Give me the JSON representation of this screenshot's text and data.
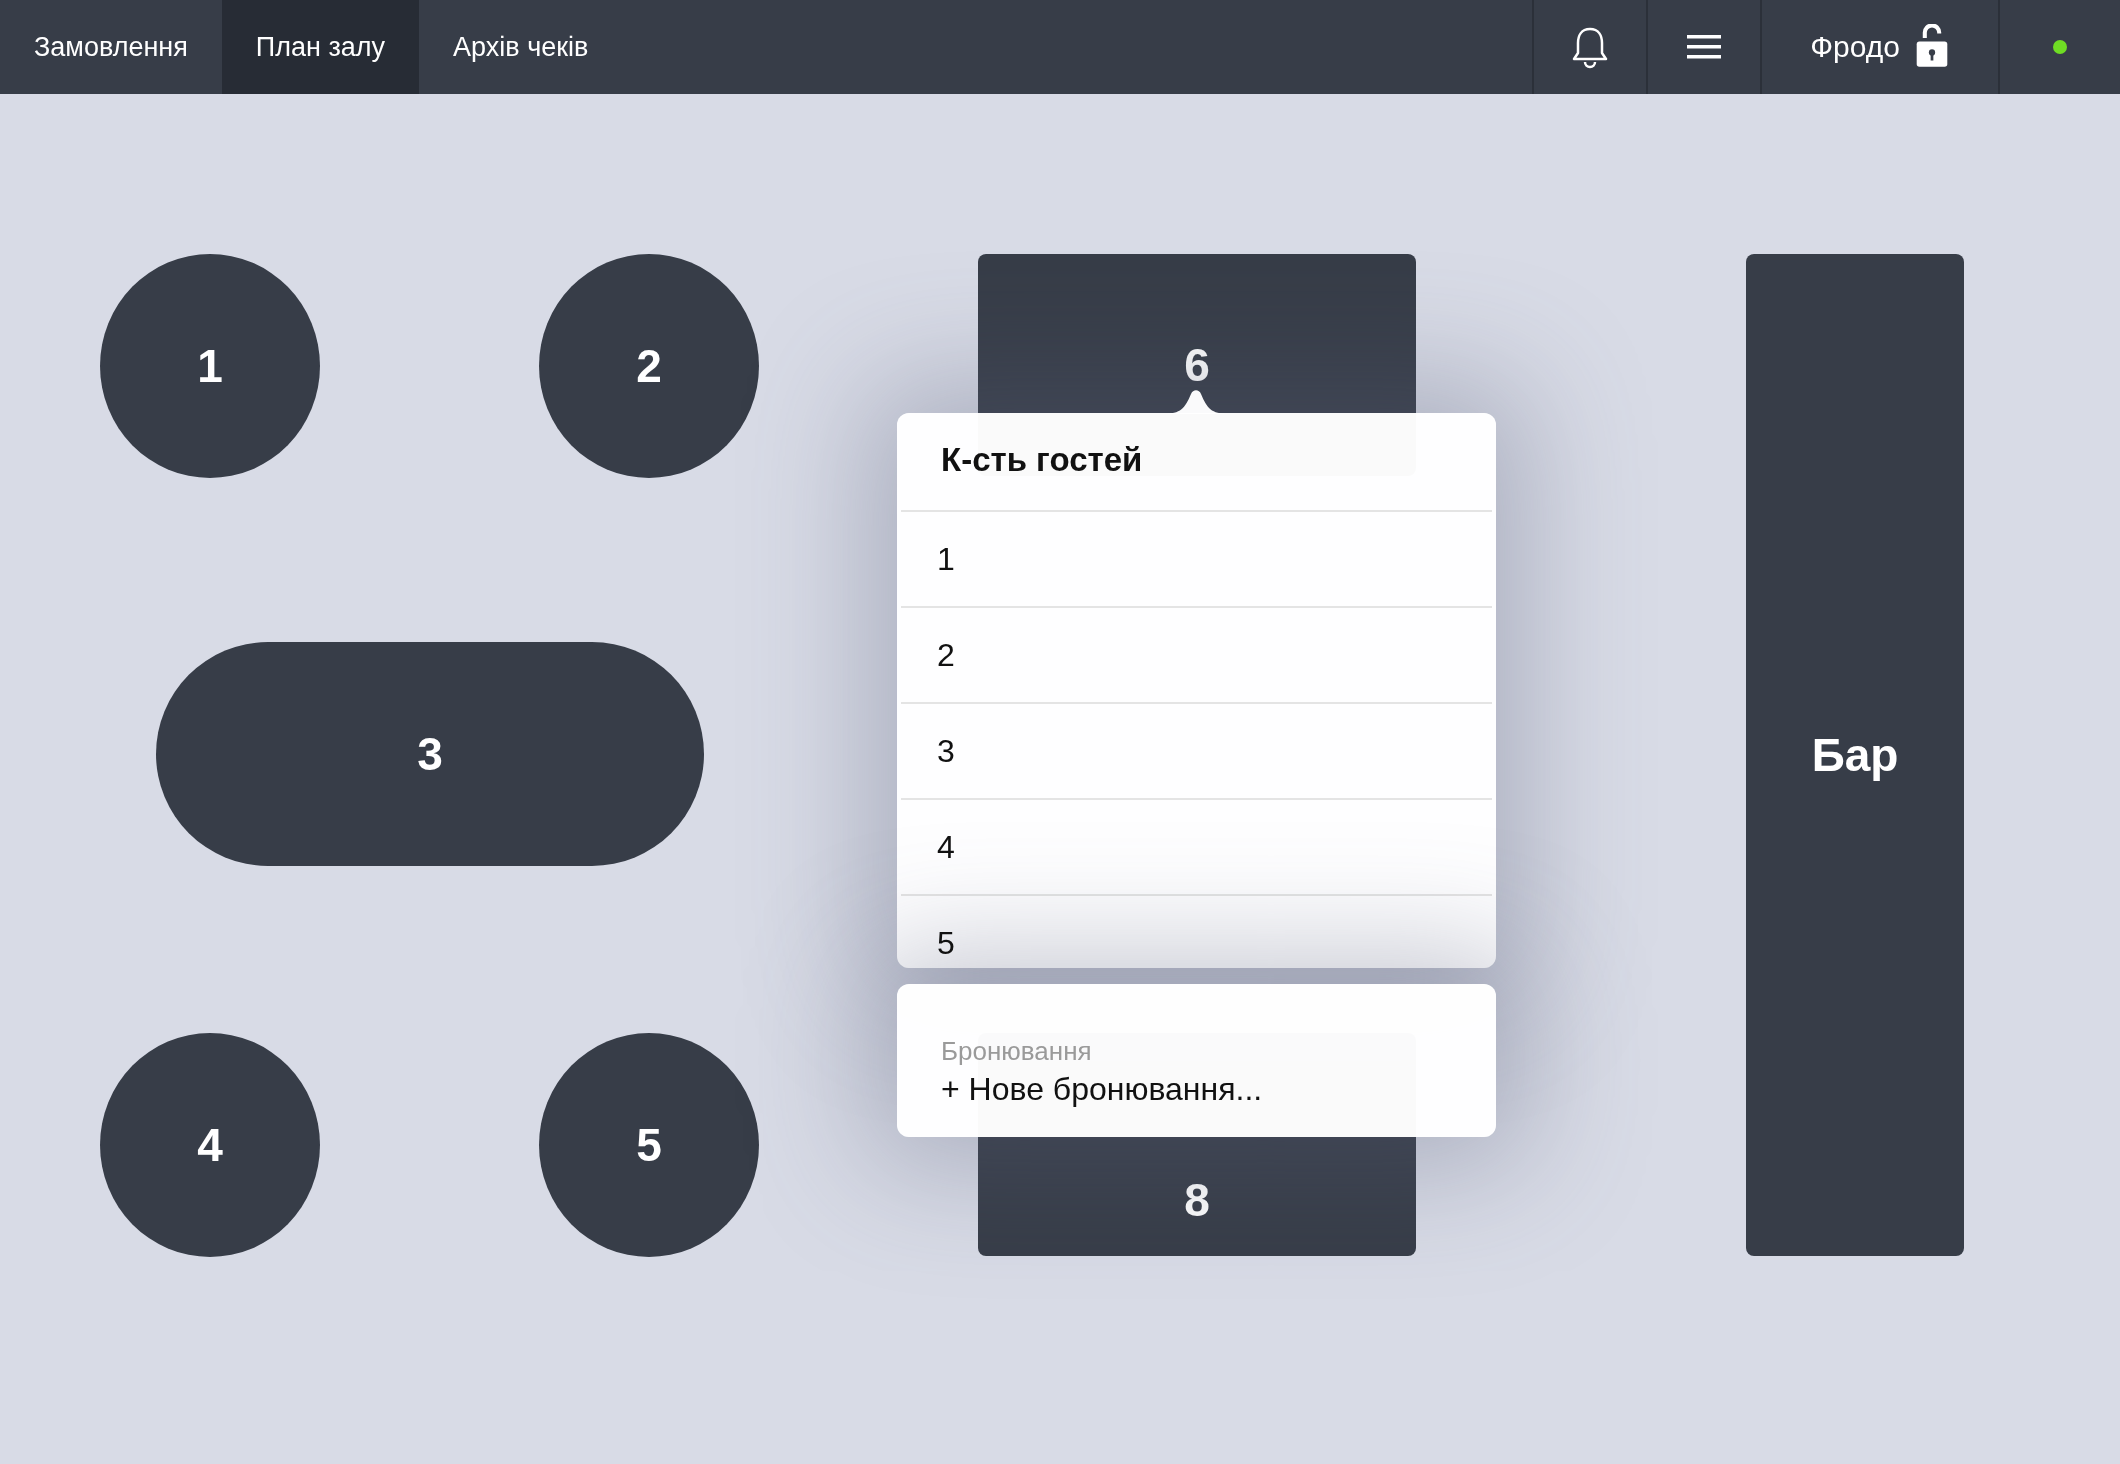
{
  "tabs": [
    {
      "label": "Замовлення",
      "selected": false
    },
    {
      "label": "План залу",
      "selected": true
    },
    {
      "label": "Архів чеків",
      "selected": false
    }
  ],
  "user": {
    "name": "Фродо",
    "locked": false
  },
  "connection": {
    "online": true
  },
  "tables": [
    {
      "label": "1",
      "kind": "round"
    },
    {
      "label": "2",
      "kind": "round"
    },
    {
      "label": "3",
      "kind": "pill"
    },
    {
      "label": "4",
      "kind": "round"
    },
    {
      "label": "5",
      "kind": "round"
    },
    {
      "label": "6",
      "kind": "rect"
    },
    {
      "label": "8",
      "kind": "rect"
    },
    {
      "label": "Бар",
      "kind": "bar"
    }
  ],
  "popup": {
    "title": "К-сть гостей",
    "options": [
      "1",
      "2",
      "3",
      "4",
      "5"
    ],
    "booking": {
      "label": "Бронювання",
      "action": "+ Нове бронювання..."
    }
  }
}
